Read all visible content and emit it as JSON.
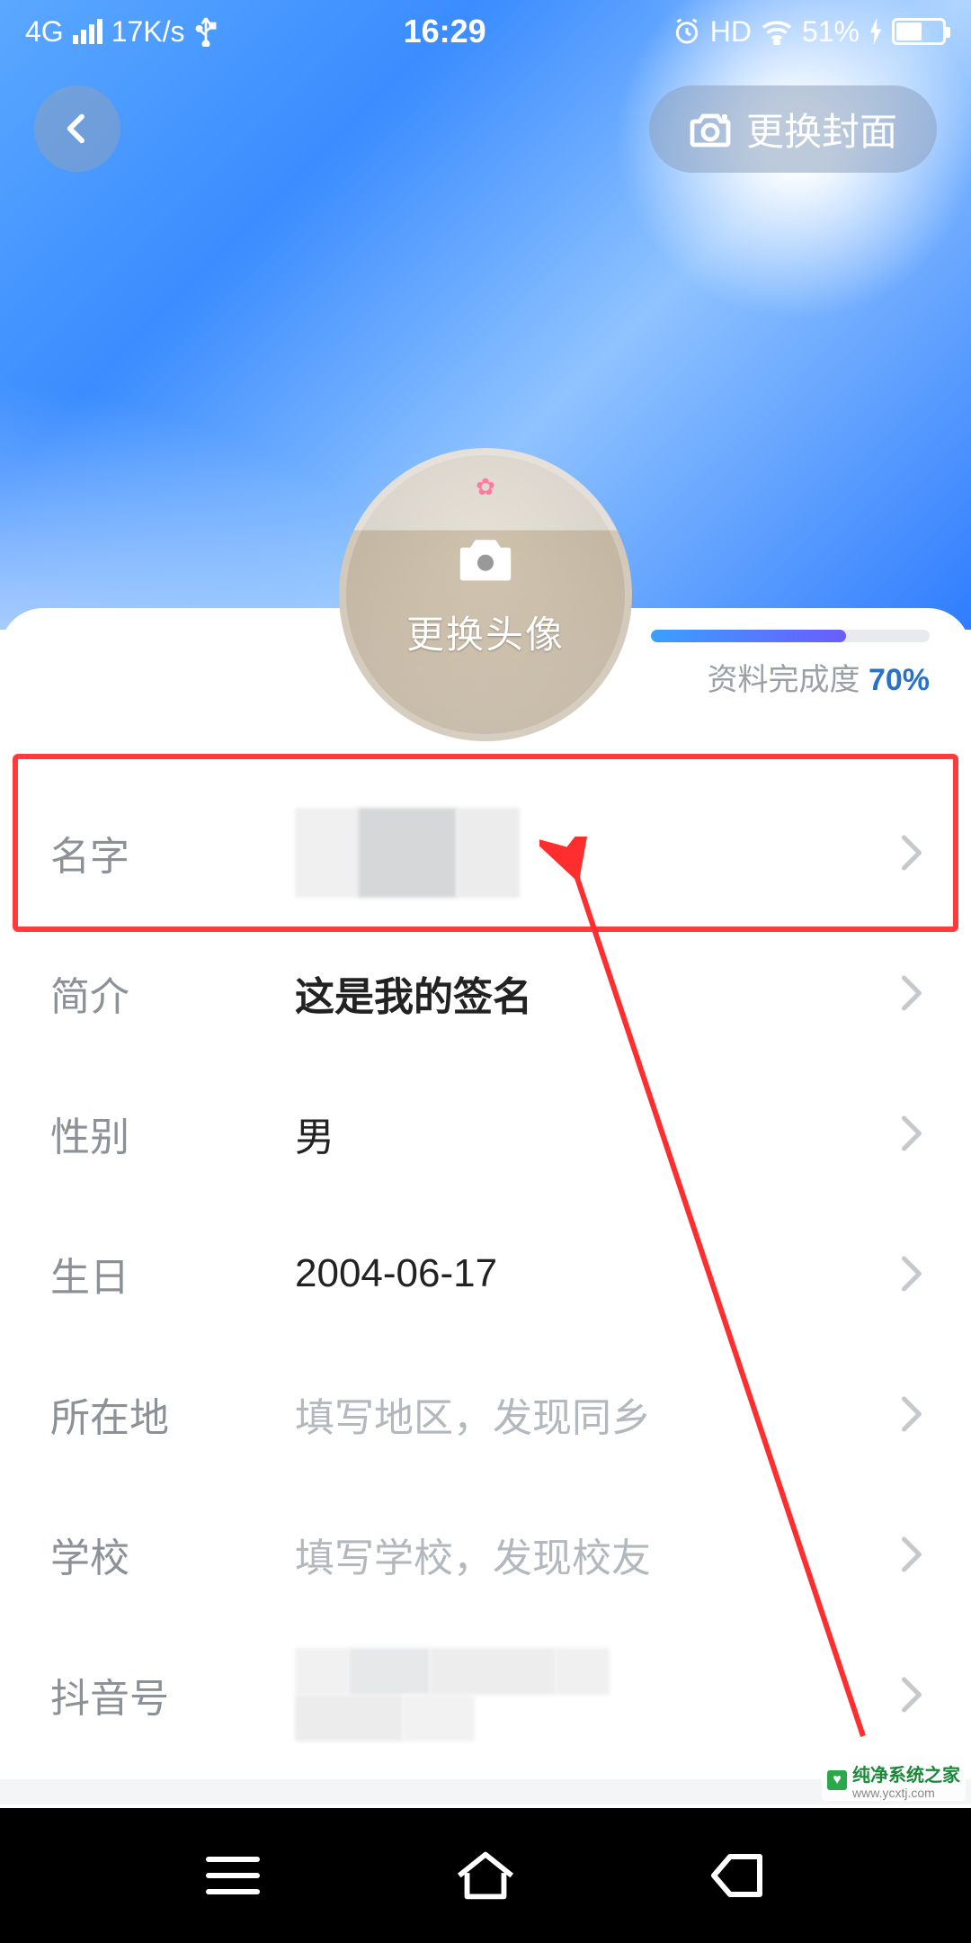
{
  "status": {
    "network": "4G",
    "speed": "17K/s",
    "time": "16:29",
    "hd": "HD",
    "battery_pct": "51%"
  },
  "header": {
    "change_cover_label": "更换封面",
    "change_avatar_label": "更换头像"
  },
  "progress": {
    "label": "资料完成度",
    "percent_text": "70%",
    "percent_value": 70
  },
  "rows": [
    {
      "key": "name",
      "label": "名字",
      "value": "",
      "placeholder": "",
      "redacted": true
    },
    {
      "key": "bio",
      "label": "简介",
      "value": "这是我的签名",
      "placeholder": "",
      "redacted": false
    },
    {
      "key": "gender",
      "label": "性别",
      "value": "男",
      "placeholder": "",
      "redacted": false
    },
    {
      "key": "birthday",
      "label": "生日",
      "value": "2004-06-17",
      "placeholder": "",
      "redacted": false
    },
    {
      "key": "location",
      "label": "所在地",
      "value": "",
      "placeholder": "填写地区，发现同乡",
      "redacted": false
    },
    {
      "key": "school",
      "label": "学校",
      "value": "",
      "placeholder": "填写学校，发现校友",
      "redacted": false
    },
    {
      "key": "douyin",
      "label": "抖音号",
      "value": "",
      "placeholder": "",
      "redacted": true
    }
  ],
  "annotation": {
    "highlighted_row_key": "name"
  },
  "watermark": {
    "title": "纯净系统之家",
    "sub": "www.ycxtj.com"
  }
}
